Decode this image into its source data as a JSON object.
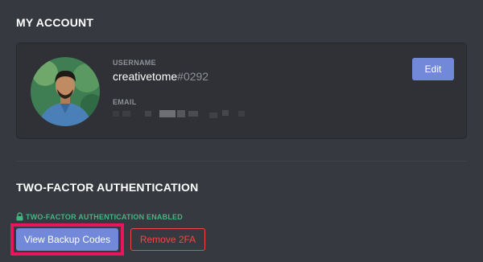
{
  "account": {
    "title": "MY ACCOUNT",
    "username_label": "USERNAME",
    "username": "creativetome",
    "discriminator": "#0292",
    "email_label": "EMAIL",
    "edit_label": "Edit"
  },
  "two_factor": {
    "title": "TWO-FACTOR AUTHENTICATION",
    "status": "TWO-FACTOR AUTHENTICATION ENABLED",
    "view_codes_label": "View Backup Codes",
    "remove_label": "Remove 2FA"
  },
  "colors": {
    "background": "#36393f",
    "card": "#2f3136",
    "accent": "#7289da",
    "enabled": "#43b581",
    "danger": "#f04747",
    "highlight": "#e8175d"
  }
}
